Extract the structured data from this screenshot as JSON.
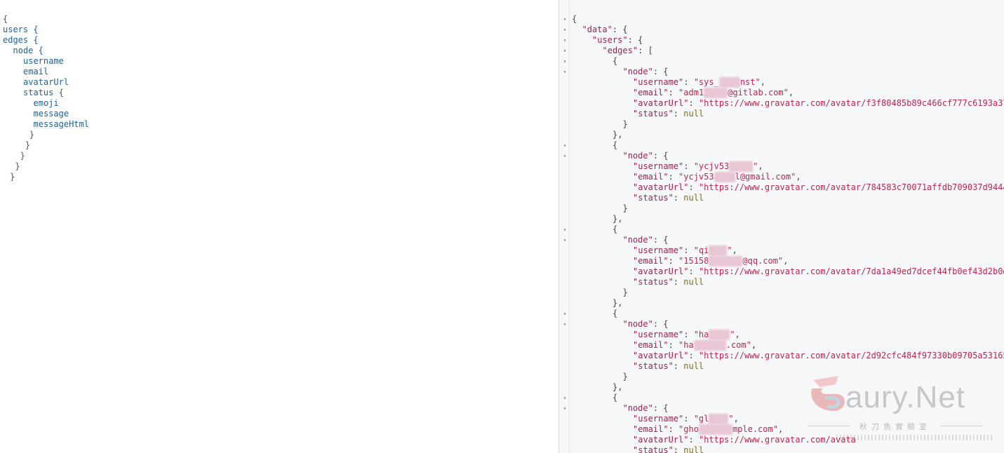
{
  "query_editor": {
    "lines": [
      {
        "text": "{",
        "indent": 0
      },
      {
        "text": "users {",
        "indent": 0
      },
      {
        "text": "edges {",
        "indent": 0
      },
      {
        "text": "node {",
        "indent": 1
      },
      {
        "text": "username",
        "indent": 2
      },
      {
        "text": "email",
        "indent": 2
      },
      {
        "text": "avatarUrl",
        "indent": 2
      },
      {
        "text": "status {",
        "indent": 2
      },
      {
        "text": "emoji",
        "indent": 3
      },
      {
        "text": "message",
        "indent": 3
      },
      {
        "text": "messageHtml",
        "indent": 3
      },
      {
        "text": "}",
        "indent": 2.6
      },
      {
        "text": "}",
        "indent": 2.2
      },
      {
        "text": "}",
        "indent": 1.7
      },
      {
        "text": "}",
        "indent": 1.2
      },
      {
        "text": "}",
        "indent": 0.7
      }
    ]
  },
  "result": {
    "fold_marker": "▾",
    "open_brace": "{",
    "data_key": "\"data\"",
    "users_key": "\"users\"",
    "edges_key": "\"edges\"",
    "node_key": "\"node\"",
    "username_key": "\"username\"",
    "email_key": "\"email\"",
    "avatar_key": "\"avatarUrl\"",
    "status_key": "\"status\"",
    "null_value": "null",
    "users": [
      {
        "username_a": "\"sys_",
        "username_b": "nst\"",
        "email_a": "\"adm1",
        "email_b": "@gitlab.com\"",
        "avatar": "\"https://www.gravatar.com/avatar/f3f80485b89c466cf777c6193a37"
      },
      {
        "username_a": "\"ycjv53",
        "username_b": "\"",
        "email_a": "\"ycjv53",
        "email_b": "l@gmail.com\"",
        "avatar": "\"https://www.gravatar.com/avatar/784583c70071affdb709037d9444"
      },
      {
        "username_a": "\"qi",
        "username_b": "\"",
        "email_a": "\"15158",
        "email_b": "@qq.com\"",
        "avatar": "\"https://www.gravatar.com/avatar/7da1a49ed7dcef44fb0ef43d2b0d"
      },
      {
        "username_a": "\"ha",
        "username_b": "\"",
        "email_a": "\"ha",
        "email_b": ".com\"",
        "avatar": "\"https://www.gravatar.com/avatar/2d92cfc484f97330b09705a53165"
      },
      {
        "username_a": "\"gl",
        "username_b": "\"",
        "email_a": "\"gho",
        "email_b": "mple.com\"",
        "avatar": "\"https://www.gravatar.com/avata"
      }
    ]
  },
  "watermark": {
    "brand": "aury.Net",
    "subtitle": "秋刀魚實驗室"
  }
}
